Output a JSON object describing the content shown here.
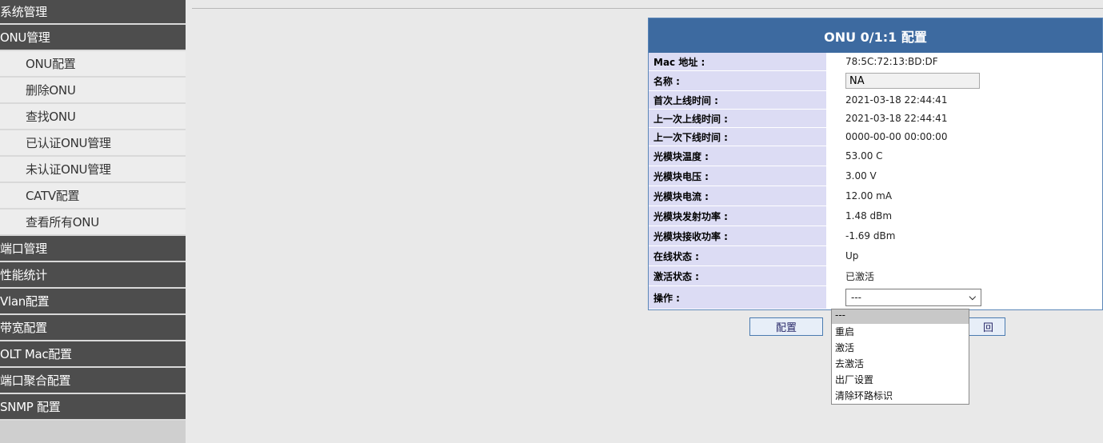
{
  "sidebar": {
    "items": [
      {
        "label": "系统管理",
        "level": "top"
      },
      {
        "label": "ONU管理",
        "level": "top"
      },
      {
        "label": "ONU配置",
        "level": "sub"
      },
      {
        "label": "删除ONU",
        "level": "sub"
      },
      {
        "label": "查找ONU",
        "level": "sub"
      },
      {
        "label": "已认证ONU管理",
        "level": "sub"
      },
      {
        "label": "未认证ONU管理",
        "level": "sub"
      },
      {
        "label": "CATV配置",
        "level": "sub"
      },
      {
        "label": "查看所有ONU",
        "level": "sub"
      },
      {
        "label": "端口管理",
        "level": "top"
      },
      {
        "label": "性能统计",
        "level": "top"
      },
      {
        "label": "Vlan配置",
        "level": "top"
      },
      {
        "label": "带宽配置",
        "level": "top"
      },
      {
        "label": "OLT Mac配置",
        "level": "top"
      },
      {
        "label": "端口聚合配置",
        "level": "top"
      },
      {
        "label": "SNMP 配置",
        "level": "top"
      }
    ]
  },
  "panel": {
    "title": "ONU 0/1:1 配置",
    "rows": [
      {
        "label": "Mac 地址 :",
        "value": "78:5C:72:13:BD:DF"
      },
      {
        "label": "名称 :",
        "value": "NA"
      },
      {
        "label": "首次上线时间 :",
        "value": "2021-03-18 22:44:41"
      },
      {
        "label": "上一次上线时间 :",
        "value": "2021-03-18 22:44:41"
      },
      {
        "label": "上一次下线时间 :",
        "value": "0000-00-00 00:00:00"
      },
      {
        "label": "光模块温度 :",
        "value": "53.00 C"
      },
      {
        "label": "光模块电压 :",
        "value": "3.00 V"
      },
      {
        "label": "光模块电流 :",
        "value": "12.00 mA"
      },
      {
        "label": "光模块发射功率 :",
        "value": "1.48 dBm"
      },
      {
        "label": "光模块接收功率 :",
        "value": "-1.69 dBm"
      },
      {
        "label": "在线状态 :",
        "value": "Up"
      },
      {
        "label": "激活状态 :",
        "value": "已激活"
      },
      {
        "label": "操作 :",
        "value": "---"
      }
    ]
  },
  "operation_options": [
    "---",
    "重启",
    "激活",
    "去激活",
    "出厂设置",
    "清除环路标识"
  ],
  "buttons": {
    "config": "配置",
    "back_partial": "回"
  },
  "colors": {
    "sidebar_top": "#4d4d4d",
    "sidebar_sub": "#ededed",
    "panel_header": "#3d6aa0",
    "label_bg": "#dcdcf4"
  }
}
